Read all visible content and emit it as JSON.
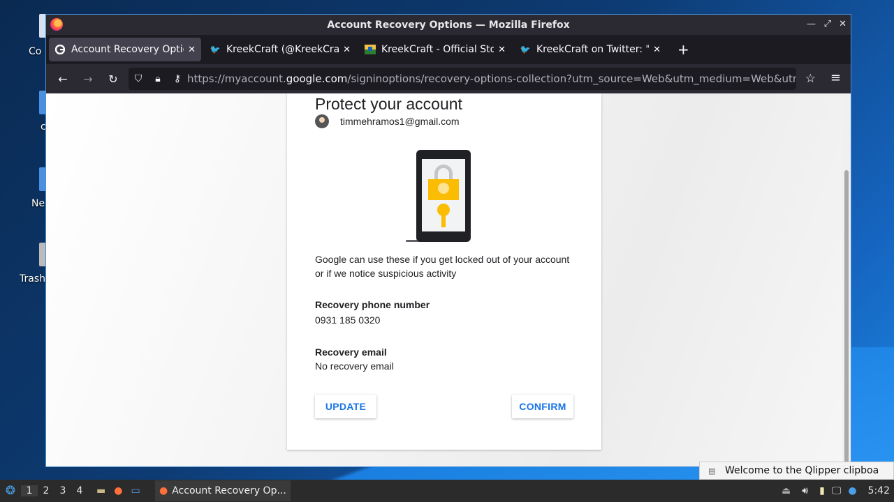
{
  "desktop": {
    "icons": [
      {
        "label": "Co"
      },
      {
        "label": "c"
      },
      {
        "label": "Ne"
      },
      {
        "label": "Trash"
      }
    ]
  },
  "window": {
    "title": "Account Recovery Options — Mozilla Firefox",
    "controls": [
      "minimize-icon",
      "maximize-icon",
      "close-icon"
    ]
  },
  "tabs": [
    {
      "label": "Account Recovery Options",
      "favicon": "google-icon",
      "active": true
    },
    {
      "label": "KreekCraft (@KreekCraft)",
      "favicon": "twitter-icon",
      "active": false
    },
    {
      "label": "KreekCraft - Official Store",
      "favicon": "store-icon",
      "active": false
    },
    {
      "label": "KreekCraft on Twitter: \"H",
      "favicon": "twitter-icon",
      "active": false
    }
  ],
  "url": {
    "prefix": "https://myaccount.",
    "domain": "google.com",
    "path": "/signinoptions/recovery-options-collection?utm_source=Web&utm_medium=Web&utm_cam"
  },
  "page": {
    "title": "Protect your account",
    "email": "timmehramos1@gmail.com",
    "description": "Google can use these if you get locked out of your account or if we notice suspicious activity",
    "phone_label": "Recovery phone number",
    "phone_value": "0931 185 0320",
    "email_label": "Recovery email",
    "email_value": "No recovery email",
    "update_button": "UPDATE",
    "confirm_button": "CONFIRM"
  },
  "colors": {
    "accent": "#1a73e8",
    "lock": "#fbbc04"
  },
  "clipboard_tip": "Welcome to the Qlipper clipboa",
  "taskbar": {
    "workspaces": [
      "1",
      "2",
      "3",
      "4"
    ],
    "active_app": "Account Recovery Op...",
    "clock": "5:42"
  }
}
